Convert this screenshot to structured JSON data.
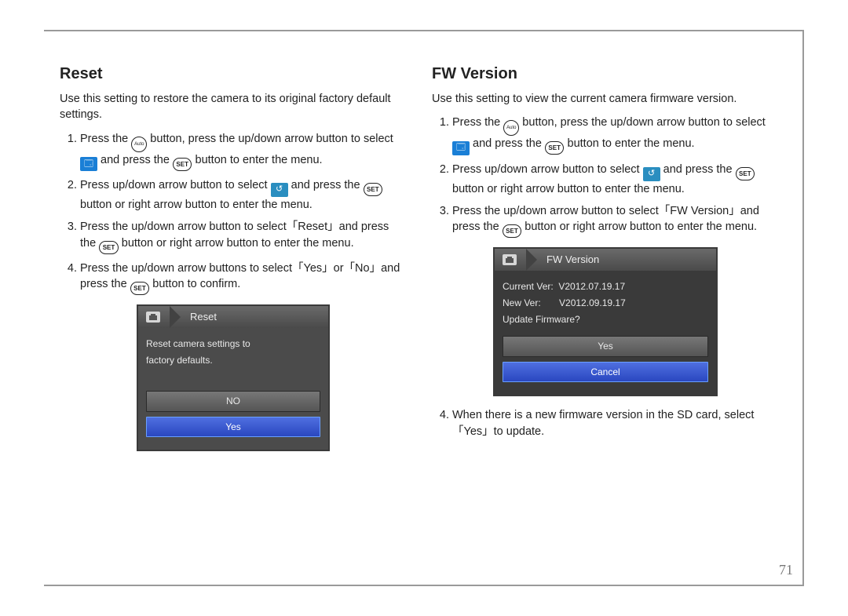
{
  "page_number": "71",
  "left": {
    "heading": "Reset",
    "intro": "Use this setting to restore the camera to its original factory default settings.",
    "steps": [
      {
        "pre": "Press the ",
        "icon1_label": "Auto",
        "mid1": " button, press the up/down arrow button to select ",
        "icon2_glyph": "🗔",
        "mid2": " and press the ",
        "icon3_label": "SET",
        "post": " button to enter the menu."
      },
      {
        "pre": "Press up/down arrow button to select ",
        "icon1_glyph": "↺",
        "mid1": " and press the ",
        "icon2_label": "SET",
        "post": " button or right arrow button to enter the menu."
      },
      {
        "text": "Press the up/down arrow button to select「Reset」and press the ",
        "icon_label": "SET",
        "post": " button or right arrow button to enter the menu."
      },
      {
        "text": "Press the up/down arrow buttons to select「Yes」or「No」and press the ",
        "icon_label": "SET",
        "post": " button to confirm."
      }
    ],
    "lcd": {
      "title": "Reset",
      "line1": "Reset camera settings to",
      "line2": "factory defaults.",
      "btn_no": "NO",
      "btn_yes": "Yes"
    }
  },
  "right": {
    "heading": "FW Version",
    "intro": "Use this setting to view the current camera firmware version.",
    "steps": [
      {
        "pre": "Press the ",
        "icon1_label": "Auto",
        "mid1": " button, press the up/down arrow button to select ",
        "icon2_glyph": "🗔",
        "mid2": " and press the ",
        "icon3_label": "SET",
        "post": " button to enter the menu."
      },
      {
        "pre": "Press up/down arrow button to select ",
        "icon1_glyph": "↺",
        "mid1": " and press the ",
        "icon2_label": "SET",
        "post": " button or right arrow button to enter the menu."
      },
      {
        "text": "Press the up/down arrow button to select「FW Version」and press the ",
        "icon_label": "SET",
        "post": " button or right arrow button to enter the menu."
      }
    ],
    "lcd": {
      "title": "FW Version",
      "current_label": "Current Ver:",
      "current_val": "V2012.07.19.17",
      "new_label": "New Ver:",
      "new_val": "V2012.09.19.17",
      "prompt": "Update Firmware?",
      "btn_yes": "Yes",
      "btn_cancel": "Cancel"
    },
    "step4": "When there is a new firmware version in the SD card, select「Yes」to update."
  }
}
